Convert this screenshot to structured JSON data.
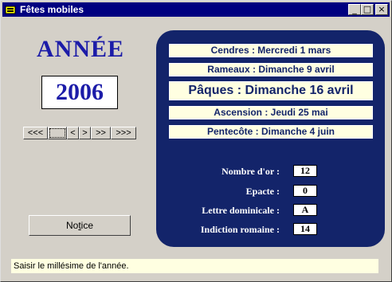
{
  "window": {
    "title": "Fêtes mobiles",
    "controls": {
      "minimize": "_",
      "maximize": "□",
      "close": "×"
    }
  },
  "year_section": {
    "heading": "ANNÉE",
    "year": "2006"
  },
  "nav_buttons": [
    "<<<",
    "",
    "<",
    ">",
    ">>",
    ">>>"
  ],
  "notice_button": {
    "prefix": "No",
    "accel": "t",
    "suffix": "ice"
  },
  "feasts": [
    {
      "label": "Cendres : Mercredi 1 mars"
    },
    {
      "label": "Rameaux : Dimanche 9 avril"
    },
    {
      "label": "Pâques : Dimanche 16 avril"
    },
    {
      "label": "Ascension : Jeudi 25 mai"
    },
    {
      "label": "Pentecôte : Dimanche 4 juin"
    }
  ],
  "computus": [
    {
      "label": "Nombre d'or :",
      "value": "12"
    },
    {
      "label": "Epacte :",
      "value": "0"
    },
    {
      "label": "Lettre dominicale :",
      "value": "A"
    },
    {
      "label": "Indiction romaine :",
      "value": "14"
    }
  ],
  "status_text": "Saisir le millésime de l'année.",
  "colors": {
    "panel": "#13246a",
    "heading": "#1c1ca8",
    "title_bar": "#000080",
    "feast_bg": "#ffffe1"
  }
}
